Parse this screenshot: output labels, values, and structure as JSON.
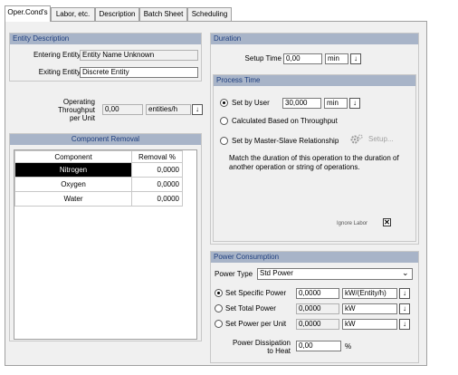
{
  "tabs": [
    {
      "label": "Oper.Cond's"
    },
    {
      "label": "Labor, etc."
    },
    {
      "label": "Description"
    },
    {
      "label": "Batch Sheet"
    },
    {
      "label": "Scheduling"
    }
  ],
  "entity": {
    "title": "Entity Description",
    "entering_label": "Entering Entity",
    "entering_value": "Entity Name Unknown",
    "exiting_label": "Exiting Entity",
    "exiting_value": "Discrete Entity"
  },
  "throughput": {
    "label_line1": "Operating",
    "label_line2": "Throughput",
    "label_line3": "per Unit",
    "value": "0,00",
    "unit": "entities/h"
  },
  "component_removal": {
    "title": "Component Removal",
    "col_component": "Component",
    "col_removal": "Removal %",
    "rows": [
      {
        "name": "Nitrogen",
        "value": "0,0000",
        "selected": true
      },
      {
        "name": "Oxygen",
        "value": "0,0000",
        "selected": false
      },
      {
        "name": "Water",
        "value": "0,0000",
        "selected": false
      }
    ]
  },
  "duration": {
    "title": "Duration",
    "setup_label": "Setup Time",
    "setup_value": "0,00",
    "setup_unit": "min"
  },
  "process_time": {
    "title": "Process Time",
    "opt_user": "Set by User",
    "user_value": "30,000",
    "user_unit": "min",
    "opt_throughput": "Calculated Based on Throughput",
    "opt_master": "Set by Master-Slave Relationship",
    "setup_btn": "Setup...",
    "desc": "Match the duration of this operation to the duration of another operation or string of operations.",
    "ignore_label": "Ignore Labor"
  },
  "power": {
    "title": "Power Consumption",
    "type_label": "Power Type",
    "type_value": "Std Power",
    "opt_specific": "Set Specific Power",
    "specific_value": "0,0000",
    "specific_unit": "kW/(Entity/h)",
    "opt_total": "Set Total Power",
    "total_value": "0,0000",
    "total_unit": "kW",
    "opt_per_unit": "Set Power per Unit",
    "per_unit_value": "0,0000",
    "per_unit_unit": "kW",
    "dissip_line1": "Power Dissipation",
    "dissip_line2": "to Heat",
    "dissip_value": "0,00",
    "dissip_unit": "%"
  }
}
